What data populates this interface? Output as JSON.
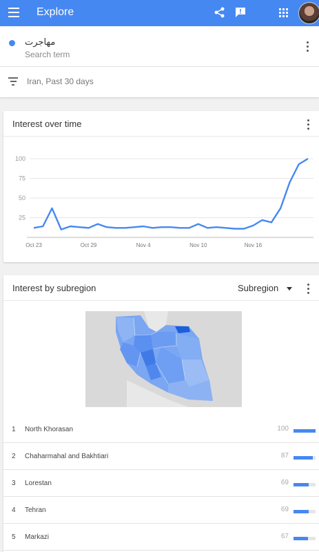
{
  "appbar": {
    "title": "Explore",
    "icons": [
      "menu-icon",
      "share-icon",
      "feedback-icon",
      "apps-icon",
      "avatar"
    ],
    "color": "#4688f1"
  },
  "search": {
    "term": "مهاجرت",
    "type_label": "Search term",
    "series_color": "#4688f1"
  },
  "filters": {
    "label": "Iran, Past 30 days"
  },
  "interest_over_time": {
    "title": "Interest over time",
    "chart_data": {
      "type": "line",
      "x_tick_labels": [
        "Oct 23",
        "Oct 29",
        "Nov 4",
        "Nov 10",
        "Nov 16"
      ],
      "y_tick_labels": [
        "100",
        "75",
        "50",
        "25"
      ],
      "ylim": [
        0,
        100
      ],
      "grid": true,
      "series": [
        {
          "values": [
            12,
            14,
            37,
            10,
            14,
            13,
            12,
            17,
            13,
            12,
            12,
            13,
            14,
            12,
            13,
            13,
            12,
            12,
            17,
            12,
            13,
            12,
            11,
            11,
            15,
            22,
            19,
            37,
            70,
            93,
            100
          ],
          "color": "#4688f1"
        }
      ]
    }
  },
  "interest_by_subregion": {
    "title": "Interest by subregion",
    "dropdown_label": "Subregion",
    "rows": [
      {
        "rank": "1",
        "name": "North Khorasan",
        "value": "100",
        "fraction": 1.0
      },
      {
        "rank": "2",
        "name": "Chaharmahal and Bakhtiari",
        "value": "87",
        "fraction": 0.87
      },
      {
        "rank": "3",
        "name": "Lorestan",
        "value": "69",
        "fraction": 0.69
      },
      {
        "rank": "4",
        "name": "Tehran",
        "value": "69",
        "fraction": 0.69
      },
      {
        "rank": "5",
        "name": "Markazi",
        "value": "67",
        "fraction": 0.67
      }
    ]
  }
}
